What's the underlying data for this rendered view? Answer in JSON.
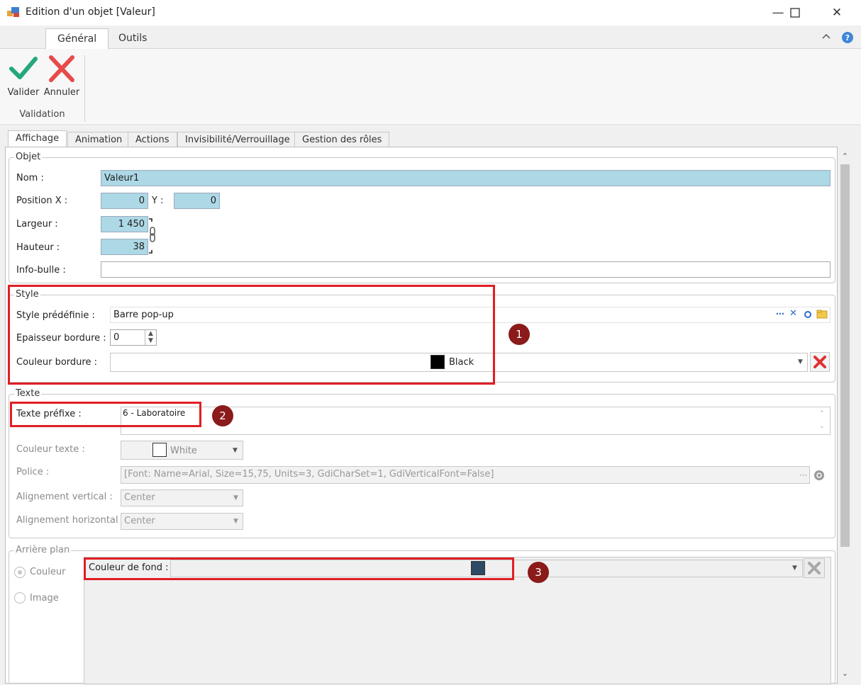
{
  "window": {
    "title": "Edition d'un objet [Valeur]"
  },
  "ribbon": {
    "tabs": [
      "Général",
      "Outils"
    ],
    "buttons": {
      "valider": "Valider",
      "annuler": "Annuler"
    },
    "group_label": "Validation"
  },
  "tabs": [
    "Affichage",
    "Animation",
    "Actions",
    "Invisibilité/Verrouillage",
    "Gestion des rôles"
  ],
  "objet": {
    "legend": "Objet",
    "nom_label": "Nom :",
    "nom_value": "Valeur1",
    "posx_label": "Position X :",
    "posx_value": "0",
    "y_label": "Y :",
    "y_value": "0",
    "largeur_label": "Largeur :",
    "largeur_value": "1 450",
    "hauteur_label": "Hauteur :",
    "hauteur_value": "38",
    "infobulle_label": "Info-bulle :",
    "infobulle_value": ""
  },
  "style": {
    "legend": "Style",
    "predef_label": "Style prédéfinie :",
    "predef_value": "Barre pop-up",
    "epaisseur_label": "Epaisseur bordure :",
    "epaisseur_value": "0",
    "couleur_label": "Couleur bordure :",
    "couleur_value": "Black",
    "couleur_hex": "#000000"
  },
  "texte": {
    "legend": "Texte",
    "prefixe_label": "Texte préfixe :",
    "prefixe_value": "6 - Laboratoire",
    "couleur_label": "Couleur texte :",
    "couleur_value": "White",
    "couleur_hex": "#ffffff",
    "police_label": "Police :",
    "police_value": "[Font: Name=Arial, Size=15,75, Units=3, GdiCharSet=1, GdiVerticalFont=False]",
    "valign_label": "Alignement vertical :",
    "valign_value": "Center",
    "halign_label": "Alignement horizontal :",
    "halign_value": "Center"
  },
  "arriere": {
    "legend": "Arrière plan",
    "radio_couleur": "Couleur",
    "radio_image": "Image",
    "fond_label": "Couleur de fond :",
    "fond_hex": "#2e4a64"
  },
  "badges": [
    "1",
    "2",
    "3"
  ]
}
